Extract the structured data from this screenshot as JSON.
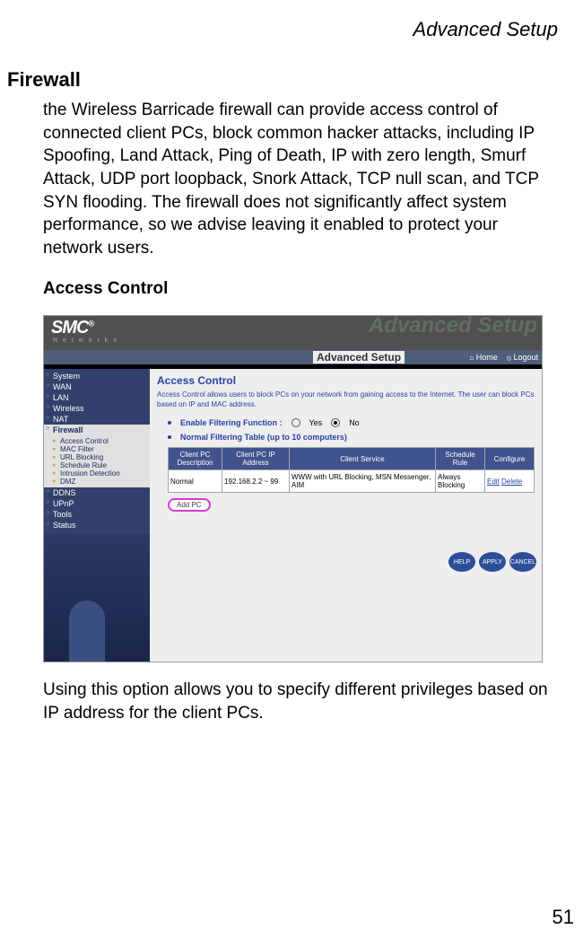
{
  "doc": {
    "running_head": "Advanced Setup",
    "page_number": "51",
    "h1": "Firewall",
    "para1": "the Wireless Barricade firewall can provide access control of connected client PCs, block common hacker attacks, including IP Spoofing, Land Attack, Ping of Death, IP with zero length, Smurf Attack, UDP port loopback, Snork Attack, TCP null scan, and TCP SYN flooding. The firewall does not significantly affect system performance, so we advise leaving it enabled to protect your network users.",
    "h2": "Access Control",
    "para2": "Using this option allows you to specify different privileges based on IP address for the client PCs."
  },
  "ui": {
    "brand": "SMC",
    "brand_reg": "®",
    "brand_sub": "N e t w o r k s",
    "adv_overlay": "Advanced Setup",
    "adv_label": "Advanced Setup",
    "home": "Home",
    "logout": "Logout",
    "sidebar": {
      "items": [
        "System",
        "WAN",
        "LAN",
        "Wireless",
        "NAT",
        "Firewall",
        "DDNS",
        "UPnP",
        "Tools",
        "Status"
      ],
      "sub": [
        "Access Control",
        "MAC Filter",
        "URL Blocking",
        "Schedule Rule",
        "Intrusion Detection",
        "DMZ"
      ]
    },
    "content": {
      "title": "Access Control",
      "desc": "Access Control allows users to block PCs on your network from gaining access to the Internet. The user can block PCs based on IP and MAC address.",
      "enable_label": "Enable Filtering Function :",
      "opt_yes": "Yes",
      "opt_no": "No",
      "table_label": "Normal Filtering Table (up to 10 computers)",
      "headers": [
        "Client PC Description",
        "Client PC IP Address",
        "Client Service",
        "Schedule Rule",
        "Configure"
      ],
      "row": {
        "desc": "Normal",
        "ip": "192.168.2.2 ~ 99",
        "service": "WWW with URL Blocking,  MSN Messenger,  AIM",
        "rule": "Always Blocking",
        "edit": "Edit",
        "delete": "Delete"
      },
      "add_pc": "Add PC",
      "btn_help": "HELP",
      "btn_apply": "APPLY",
      "btn_cancel": "CANCEL"
    }
  }
}
